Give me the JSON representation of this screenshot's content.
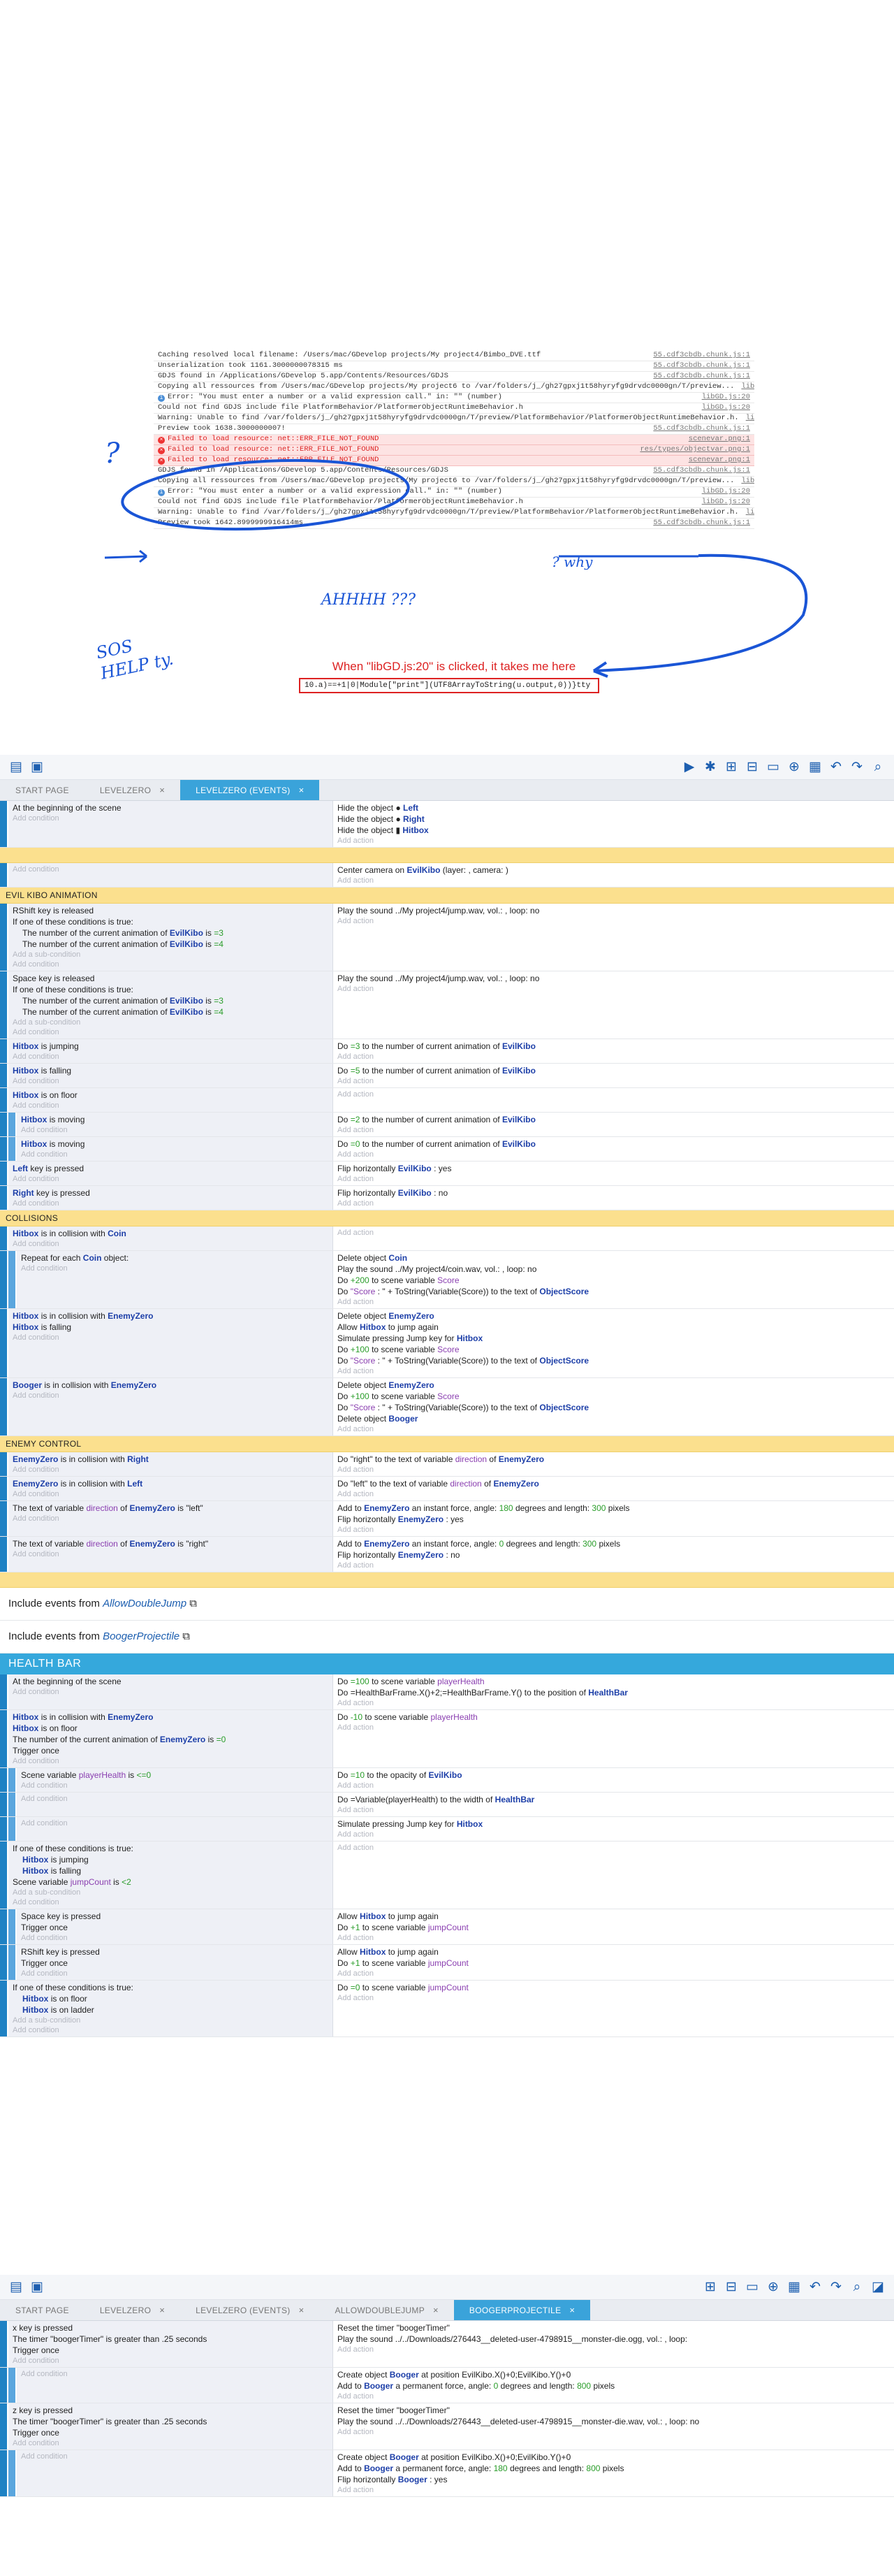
{
  "console": {
    "lines": [
      {
        "t": "Caching resolved local filename: /Users/mac/GDevelop projects/My project4/Bimbo_DVE.ttf",
        "s": "55.cdf3cbdb.chunk.js:1",
        "k": ""
      },
      {
        "t": "Unserialization took 1161.3000000078315 ms",
        "s": "55.cdf3cbdb.chunk.js:1",
        "k": ""
      },
      {
        "t": "GDJS found in /Applications/GDevelop 5.app/Contents/Resources/GDJS",
        "s": "55.cdf3cbdb.chunk.js:1",
        "k": ""
      },
      {
        "t": "Copying all ressources from /Users/mac/GDevelop projects/My project6 to /var/folders/j_/gh27gpxj1t58hyryfg9drvdc0000gn/T/preview...",
        "s": "libGD.js:20",
        "k": ""
      },
      {
        "t": "Error: \"You must enter a number or a valid expression call.\" in: \"\" (number)",
        "s": "libGD.js:20",
        "k": "info"
      },
      {
        "t": "Could not find GDJS include file PlatformBehavior/PlatformerObjectRuntimeBehavior.h",
        "s": "libGD.js:20",
        "k": ""
      },
      {
        "t": "Warning: Unable to find /var/folders/j_/gh27gpxj1t58hyryfg9drvdc0000gn/T/preview/PlatformBehavior/PlatformerObjectRuntimeBehavior.h.",
        "s": "libGD.js:20",
        "k": ""
      },
      {
        "t": "Preview took 1638.3000000007!",
        "s": "55.cdf3cbdb.chunk.js:1",
        "k": ""
      },
      {
        "t": "Failed to load resource: net::ERR_FILE_NOT_FOUND",
        "s": "scenevar.png:1",
        "k": "err"
      },
      {
        "t": "Failed to load resource: net::ERR_FILE_NOT_FOUND",
        "s": "res/types/objectvar.png:1",
        "k": "err"
      },
      {
        "t": "Failed to load resource: net::ERR_FILE_NOT_FOUND",
        "s": "scenevar.png:1",
        "k": "err"
      },
      {
        "t": "GDJS found in /Applications/GDevelop 5.app/Contents/Resources/GDJS",
        "s": "55.cdf3cbdb.chunk.js:1",
        "k": ""
      },
      {
        "t": "Copying all ressources from /Users/mac/GDevelop projects/My project6 to /var/folders/j_/gh27gpxj1t58hyryfg9drvdc0000gn/T/preview...",
        "s": "libGD.js:20",
        "k": ""
      },
      {
        "t": "Error: \"You must enter a number or a valid expression call.\" in: \"\" (number)",
        "s": "libGD.js:20",
        "k": "info"
      },
      {
        "t": "Could not find GDJS include file PlatformBehavior/PlatformerObjectRuntimeBehavior.h",
        "s": "libGD.js:20",
        "k": ""
      },
      {
        "t": "Warning: Unable to find /var/folders/j_/gh27gpxj1t58hyryfg9drvdc0000gn/T/preview/PlatformBehavior/PlatformerObjectRuntimeBehavior.h.",
        "s": "libGD.js:20",
        "k": ""
      },
      {
        "t": "Preview took 1642.8999999916414ms",
        "s": "55.cdf3cbdb.chunk.js:1",
        "k": ""
      }
    ]
  },
  "annot": {
    "q": "?",
    "why": "? why",
    "ahh": "AHHHH ???",
    "sos": "SOS HELP ty.",
    "note": "When \"libGD.js:20\" is clicked, it takes me here",
    "code": "10.a)==+1|0|Module[\"print\"](UTF8ArrayToString(u.output,0))}tty"
  },
  "tabs1": [
    "START PAGE",
    "LEVELZERO",
    "LEVELZERO (EVENTS)"
  ],
  "tabs2": [
    "START PAGE",
    "LEVELZERO",
    "LEVELZERO (EVENTS)",
    "ALLOWDOUBLEJUMP",
    "BOOGERPROJECTILE"
  ],
  "add_condition": "Add condition",
  "add_action": "Add action",
  "add_sub": "Add a sub-condition",
  "events1": [
    {
      "t": "ev",
      "c": [
        "At the beginning of the scene"
      ],
      "a": [
        "Hide the object ● Left",
        "Hide the object ● Right",
        "Hide the object ▮ Hitbox"
      ]
    },
    {
      "t": "ge"
    },
    {
      "t": "ev",
      "c": [],
      "a": [
        "Center camera on EvilKibo (layer: , camera: )"
      ]
    },
    {
      "t": "g",
      "l": "EVIL KIBO ANIMATION"
    },
    {
      "t": "ev",
      "c": [
        "RShift key is released",
        "If one of these conditions is true:",
        "  The number of the current animation of EvilKibo is =3",
        "  The number of the current animation of EvilKibo is =4"
      ],
      "s": 1,
      "a": [
        "Play the sound ../My project4/jump.wav, vol.: , loop: no"
      ]
    },
    {
      "t": "ev",
      "c": [
        "Space key is released",
        "If one of these conditions is true:",
        "  The number of the current animation of EvilKibo is =3",
        "  The number of the current animation of EvilKibo is =4"
      ],
      "s": 1,
      "a": [
        "Play the sound ../My project4/jump.wav, vol.: , loop: no"
      ]
    },
    {
      "t": "ev",
      "c": [
        "Hitbox is jumping"
      ],
      "a": [
        "Do =3 to the number of current animation of EvilKibo"
      ]
    },
    {
      "t": "ev",
      "c": [
        "Hitbox is falling"
      ],
      "a": [
        "Do =5 to the number of current animation of EvilKibo"
      ]
    },
    {
      "t": "ev",
      "c": [
        "Hitbox is on floor"
      ],
      "a": []
    },
    {
      "t": "sub",
      "c": [
        "Hitbox is moving"
      ],
      "a": [
        "Do =2 to the number of current animation of EvilKibo"
      ]
    },
    {
      "t": "sub",
      "c": [
        "Hitbox is moving"
      ],
      "a": [
        "Do =0 to the number of current animation of EvilKibo"
      ]
    },
    {
      "t": "ev",
      "c": [
        "Left key is pressed"
      ],
      "a": [
        "Flip horizontally EvilKibo : yes"
      ]
    },
    {
      "t": "ev",
      "c": [
        "Right key is pressed"
      ],
      "a": [
        "Flip horizontally EvilKibo : no"
      ]
    },
    {
      "t": "g",
      "l": "COLLISIONS"
    },
    {
      "t": "ev",
      "c": [
        "Hitbox is in collision with Coin"
      ],
      "a": []
    },
    {
      "t": "sub",
      "c": [
        "Repeat for each Coin object:"
      ],
      "a": [
        "Delete object Coin",
        "Play the sound ../My project4/coin.wav, vol.: , loop: no",
        "Do +200 to scene variable Score",
        "Do \"Score : \" + ToString(Variable(Score)) to the text of ObjectScore"
      ]
    },
    {
      "t": "ev",
      "c": [
        "Hitbox is in collision with EnemyZero",
        "Hitbox is falling"
      ],
      "a": [
        "Delete object EnemyZero",
        "Allow Hitbox to jump again",
        "Simulate pressing Jump key for Hitbox",
        "Do +100 to scene variable Score",
        "Do \"Score : \" + ToString(Variable(Score)) to the text of ObjectScore"
      ]
    },
    {
      "t": "ev",
      "c": [
        "Booger is in collision with EnemyZero"
      ],
      "a": [
        "Delete object EnemyZero",
        "Do +100 to scene variable Score",
        "Do \"Score : \" + ToString(Variable(Score)) to the text of ObjectScore",
        "Delete object Booger"
      ]
    },
    {
      "t": "g",
      "l": "ENEMY CONTROL"
    },
    {
      "t": "ev",
      "c": [
        "EnemyZero is in collision with Right"
      ],
      "a": [
        "Do \"right\" to the text of variable direction of EnemyZero"
      ]
    },
    {
      "t": "ev",
      "c": [
        "EnemyZero is in collision with Left"
      ],
      "a": [
        "Do \"left\" to the text of variable direction of EnemyZero"
      ]
    },
    {
      "t": "ev",
      "c": [
        "The text of variable direction of EnemyZero is \"left\""
      ],
      "a": [
        "Add to EnemyZero an instant force, angle: 180 degrees and length: 300 pixels",
        "Flip horizontally EnemyZero : yes"
      ]
    },
    {
      "t": "ev",
      "c": [
        "The text of variable direction of EnemyZero is \"right\""
      ],
      "a": [
        "Add to EnemyZero an instant force, angle: 0 degrees and length: 300 pixels",
        "Flip horizontally EnemyZero : no"
      ]
    },
    {
      "t": "ge"
    },
    {
      "t": "inc",
      "l": "Include events from",
      "e": "AllowDoubleJump"
    },
    {
      "t": "inc",
      "l": "Include events from",
      "e": "BoogerProjectile"
    },
    {
      "t": "hb",
      "l": "HEALTH BAR"
    },
    {
      "t": "ev",
      "c": [
        "At the beginning of the scene"
      ],
      "a": [
        "Do =100 to scene variable playerHealth",
        "Do =HealthBarFrame.X()+2;=HealthBarFrame.Y() to the position of HealthBar"
      ]
    },
    {
      "t": "ev",
      "c": [
        "Hitbox is in collision with EnemyZero",
        "Hitbox is on floor",
        "The number of the current animation of EnemyZero is =0",
        "Trigger once"
      ],
      "a": [
        "Do -10 to scene variable playerHealth"
      ]
    },
    {
      "t": "sub",
      "c": [
        "Scene variable playerHealth is <=0"
      ],
      "a": [
        "Do =10 to the opacity of EvilKibo"
      ]
    },
    {
      "t": "sub",
      "c": [],
      "a": [
        "Do =Variable(playerHealth) to the width of HealthBar"
      ]
    },
    {
      "t": "sub",
      "c": [],
      "a": [
        "Simulate pressing Jump key for Hitbox"
      ]
    },
    {
      "t": "ev",
      "c": [
        "If one of these conditions is true:",
        "  Hitbox is jumping",
        "  Hitbox is falling",
        "Scene variable jumpCount is <2"
      ],
      "s": 2,
      "a": []
    },
    {
      "t": "sub",
      "c": [
        "Space key is pressed",
        "Trigger once"
      ],
      "a": [
        "Allow Hitbox to jump again",
        "Do +1 to scene variable jumpCount"
      ]
    },
    {
      "t": "sub",
      "c": [
        "RShift key is pressed",
        "Trigger once"
      ],
      "a": [
        "Allow Hitbox to jump again",
        "Do +1 to scene variable jumpCount"
      ]
    },
    {
      "t": "ev",
      "c": [
        "If one of these conditions is true:",
        "  Hitbox is on floor",
        "  Hitbox is on ladder"
      ],
      "s": 3,
      "a": [
        "Do =0 to scene variable jumpCount"
      ]
    }
  ],
  "events2": [
    {
      "t": "ev",
      "c": [
        "x key is pressed",
        "The timer \"boogerTimer\" is greater than .25 seconds",
        "Trigger once"
      ],
      "a": [
        "Reset the timer \"boogerTimer\"",
        "Play the sound ../../Downloads/276443__deleted-user-4798915__monster-die.ogg, vol.: , loop:"
      ]
    },
    {
      "t": "sub",
      "c": [],
      "a": [
        "Create object Booger at position EvilKibo.X()+0;EvilKibo.Y()+0",
        "Add to Booger a permanent force, angle: 0 degrees and length: 800 pixels"
      ]
    },
    {
      "t": "ev",
      "c": [
        "z key is pressed",
        "The timer \"boogerTimer\" is greater than .25 seconds",
        "Trigger once"
      ],
      "a": [
        "Reset the timer \"boogerTimer\"",
        "Play the sound ../../Downloads/276443__deleted-user-4798915__monster-die.wav, vol.: , loop: no"
      ]
    },
    {
      "t": "sub",
      "c": [],
      "a": [
        "Create object Booger at position EvilKibo.X()+0;EvilKibo.Y()+0",
        "Add to Booger a permanent force, angle: 180 degrees and length: 800 pixels",
        "Flip horizontally Booger : yes"
      ]
    }
  ],
  "toolbar_icons": [
    "events-file-icon",
    "scene-icon",
    "play-icon",
    "debug-icon",
    "add-event-icon",
    "add-subevent-icon",
    "add-comment-icon",
    "add-more-icon",
    "delete-icon",
    "undo-icon",
    "redo-icon",
    "search-icon"
  ]
}
